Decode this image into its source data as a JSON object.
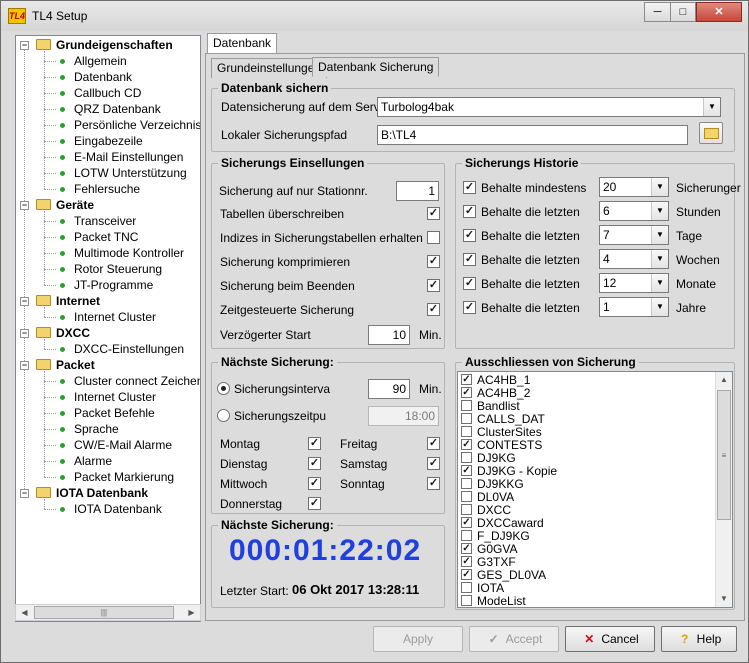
{
  "window": {
    "title": "TL4 Setup",
    "app_icon_text": "TL4",
    "minimize": "─",
    "maximize": "□",
    "close": "✕"
  },
  "tree": {
    "groups": [
      {
        "label": "Grundeigenschaften",
        "items": [
          "Allgemein",
          "Datenbank",
          "Callbuch CD",
          "QRZ Datenbank",
          "Persönliche Verzeichnisse.",
          "Eingabezeile",
          "E-Mail Einstellungen",
          "LOTW Unterstützung",
          "Fehlersuche"
        ]
      },
      {
        "label": "Geräte",
        "items": [
          "Transceiver",
          "Packet TNC",
          "Multimode Kontroller",
          "Rotor Steuerung",
          "JT-Programme"
        ]
      },
      {
        "label": "Internet",
        "items": [
          "Internet Cluster"
        ]
      },
      {
        "label": "DXCC",
        "items": [
          "DXCC-Einstellungen"
        ]
      },
      {
        "label": "Packet",
        "items": [
          "Cluster connect Zeichenfo",
          "Internet Cluster",
          "Packet Befehle",
          "Sprache",
          "CW/E-Mail Alarme",
          "Alarme",
          "Packet Markierung"
        ]
      },
      {
        "label": "IOTA Datenbank",
        "items": [
          "IOTA Datenbank"
        ]
      }
    ],
    "scroll_thumb_glyph": "|||"
  },
  "tabs": {
    "top": "Datenbank",
    "sub": [
      "Grundeinstellungen",
      "Datenbank Sicherung"
    ]
  },
  "datenbank_sichern": {
    "title": "Datenbank sichern",
    "server_label": "Datensicherung auf dem Server:",
    "server_value": "Turbolog4bak",
    "path_label": "Lokaler Sicherungspfad",
    "path_value": "B:\\TL4"
  },
  "einstellungen": {
    "title": "Sicherungs Einsellungen",
    "station_label": "Sicherung auf nur Stationnr.",
    "station_value": "1",
    "options": [
      {
        "label": "Tabellen überschreiben",
        "checked": true
      },
      {
        "label": "Indizes in Sicherungstabellen erhalten",
        "checked": false
      },
      {
        "label": "Sicherung komprimieren",
        "checked": true
      },
      {
        "label": "Sicherung beim Beenden",
        "checked": true
      },
      {
        "label": "Zeitgesteuerte Sicherung",
        "checked": true
      }
    ],
    "delay_label": "Verzögerter Start",
    "delay_value": "10",
    "delay_unit": "Min."
  },
  "historie": {
    "title": "Sicherungs Historie",
    "rows": [
      {
        "label": "Behalte mindestens",
        "value": "20",
        "unit": "Sicherunger"
      },
      {
        "label": "Behalte die letzten",
        "value": "6",
        "unit": "Stunden"
      },
      {
        "label": "Behalte die letzten",
        "value": "7",
        "unit": "Tage"
      },
      {
        "label": "Behalte die letzten",
        "value": "4",
        "unit": "Wochen"
      },
      {
        "label": "Behalte die letzten",
        "value": "12",
        "unit": "Monate"
      },
      {
        "label": "Behalte die letzten",
        "value": "1",
        "unit": "Jahre"
      }
    ]
  },
  "naechste": {
    "title": "Nächste Sicherung:",
    "interval_label": "Sicherungsinterva",
    "interval_value": "90",
    "interval_unit": "Min.",
    "time_label": "Sicherungszeitpu",
    "time_value": "18:00",
    "days": [
      {
        "label": "Montag",
        "checked": true
      },
      {
        "label": "Freitag",
        "checked": true
      },
      {
        "label": "Dienstag",
        "checked": true
      },
      {
        "label": "Samstag",
        "checked": true
      },
      {
        "label": "Mittwoch",
        "checked": true
      },
      {
        "label": "Sonntag",
        "checked": true
      },
      {
        "label": "Donnerstag",
        "checked": true
      }
    ]
  },
  "countdown": {
    "title": "Nächste Sicherung:",
    "timer": "000:01:22:02",
    "last_label": "Letzter Start:",
    "last_value": "06 Okt 2017 13:28:11"
  },
  "ausschliessen": {
    "title": "Ausschliessen von Sicherung",
    "items": [
      {
        "label": "AC4HB_1",
        "checked": true
      },
      {
        "label": "AC4HB_2",
        "checked": true
      },
      {
        "label": "Bandlist",
        "checked": false
      },
      {
        "label": "CALLS_DAT",
        "checked": false
      },
      {
        "label": "ClusterSites",
        "checked": false
      },
      {
        "label": "CONTESTS",
        "checked": true
      },
      {
        "label": "DJ9KG",
        "checked": false
      },
      {
        "label": "DJ9KG - Kopie",
        "checked": true
      },
      {
        "label": "DJ9KKG",
        "checked": false
      },
      {
        "label": "DL0VA",
        "checked": false
      },
      {
        "label": "DXCC",
        "checked": false
      },
      {
        "label": "DXCCaward",
        "checked": true
      },
      {
        "label": "F_DJ9KG",
        "checked": false
      },
      {
        "label": "G0GVA",
        "checked": true
      },
      {
        "label": "G3TXF",
        "checked": true
      },
      {
        "label": "GES_DL0VA",
        "checked": true
      },
      {
        "label": "IOTA",
        "checked": false
      },
      {
        "label": "ModeList",
        "checked": false
      }
    ]
  },
  "buttons": {
    "apply": "Apply",
    "accept": "Accept",
    "cancel": "Cancel",
    "help": "Help"
  }
}
